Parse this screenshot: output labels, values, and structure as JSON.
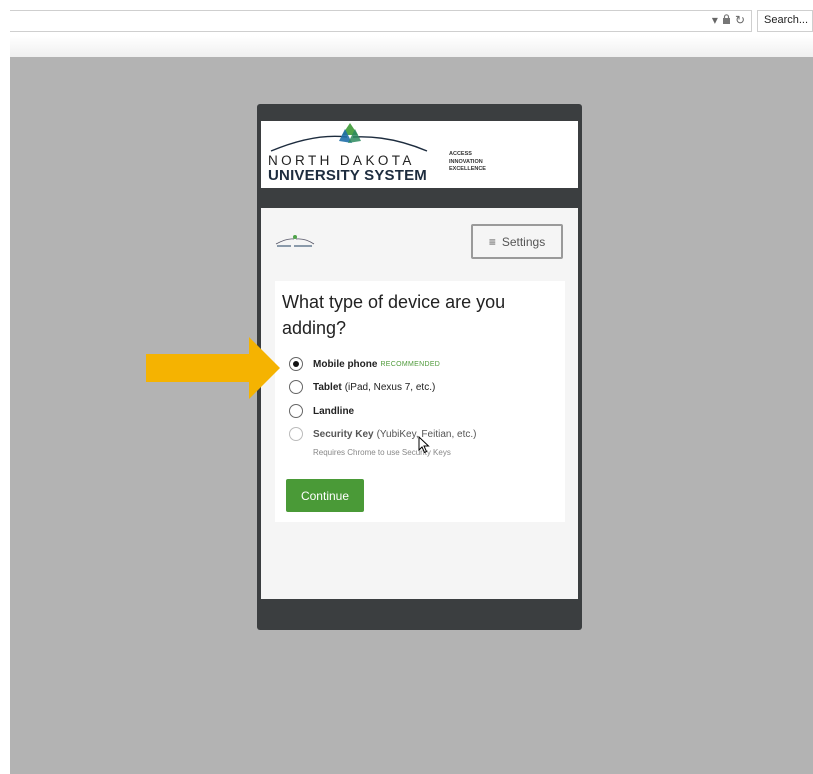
{
  "browser": {
    "search_label": "Search...",
    "url_icons": [
      "dropdown-icon",
      "lock-icon",
      "reload-icon"
    ]
  },
  "logo": {
    "line1": "NORTH DAKOTA",
    "line2": "UNIVERSITY SYSTEM",
    "tagline": [
      "ACCESS",
      "INNOVATION",
      "EXCELLENCE"
    ]
  },
  "settings": {
    "label": "Settings",
    "icon": "menu-icon"
  },
  "form": {
    "question": "What type of device are you adding?",
    "options": [
      {
        "label": "Mobile phone",
        "extra": "RECOMMENDED",
        "checked": true,
        "disabled": false
      },
      {
        "label": "Tablet",
        "extra": "(iPad, Nexus 7, etc.)",
        "checked": false,
        "disabled": false
      },
      {
        "label": "Landline",
        "extra": "",
        "checked": false,
        "disabled": false
      },
      {
        "label": "Security Key",
        "extra": "(YubiKey, Feitian, etc.)",
        "checked": false,
        "disabled": true
      }
    ],
    "security_note": "Requires Chrome to use Security Keys",
    "continue_label": "Continue"
  },
  "colors": {
    "continue_green": "#4a9a37",
    "recommended_green": "#4f9a3a",
    "arrow_yellow": "#f5b301",
    "frame_dark": "#3b3e40",
    "backdrop_gray": "#b3b3b3"
  }
}
